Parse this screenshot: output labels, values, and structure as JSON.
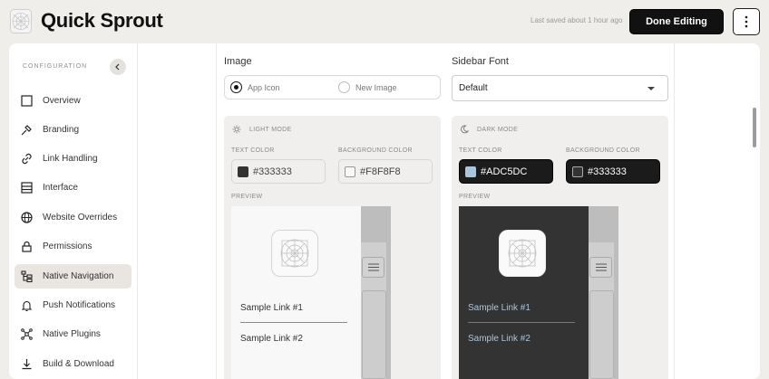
{
  "header": {
    "app_title": "Quick Sprout",
    "saved_text": "Last saved about 1 hour ago",
    "done_label": "Done Editing"
  },
  "sidebar": {
    "section_label": "CONFIGURATION",
    "items": [
      {
        "label": "Overview",
        "icon": "square-icon"
      },
      {
        "label": "Branding",
        "icon": "brush-icon"
      },
      {
        "label": "Link Handling",
        "icon": "link-icon"
      },
      {
        "label": "Interface",
        "icon": "layout-icon"
      },
      {
        "label": "Website Overrides",
        "icon": "globe-icon"
      },
      {
        "label": "Permissions",
        "icon": "lock-icon"
      },
      {
        "label": "Native Navigation",
        "icon": "navigation-icon",
        "active": true
      },
      {
        "label": "Push Notifications",
        "icon": "bell-icon"
      },
      {
        "label": "Native Plugins",
        "icon": "plugins-icon"
      },
      {
        "label": "Build & Download",
        "icon": "download-icon"
      }
    ]
  },
  "image_section": {
    "label": "Image",
    "option_app_icon": "App Icon",
    "option_new_image": "New Image",
    "selected": "App Icon"
  },
  "font_section": {
    "label": "Sidebar Font",
    "value": "Default"
  },
  "light_mode": {
    "title": "LIGHT MODE",
    "text_color_label": "TEXT COLOR",
    "text_color": "#333333",
    "bg_color_label": "BACKGROUND COLOR",
    "bg_color": "#F8F8F8",
    "preview_label": "PREVIEW",
    "link1": "Sample Link #1",
    "link2": "Sample Link #2"
  },
  "dark_mode": {
    "title": "DARK MODE",
    "text_color_label": "TEXT COLOR",
    "text_color": "#ADC5DC",
    "bg_color_label": "BACKGROUND COLOR",
    "bg_color": "#333333",
    "preview_label": "PREVIEW",
    "link1": "Sample Link #1",
    "link2": "Sample Link #2"
  },
  "colors": {
    "accent": "#111111",
    "active_nav_bg": "#e9e6e2"
  }
}
